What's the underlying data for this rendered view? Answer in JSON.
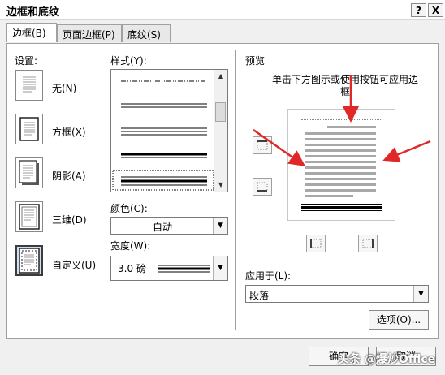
{
  "window": {
    "title": "边框和底纹",
    "help": "?",
    "close": "X"
  },
  "tabs": [
    {
      "label": "边框(B)"
    },
    {
      "label": "页面边框(P)"
    },
    {
      "label": "底纹(S)"
    }
  ],
  "settings": {
    "heading": "设置:",
    "items": [
      {
        "label": "无(N)"
      },
      {
        "label": "方框(X)"
      },
      {
        "label": "阴影(A)"
      },
      {
        "label": "三维(D)"
      },
      {
        "label": "自定义(U)"
      }
    ]
  },
  "style": {
    "heading": "样式(Y):"
  },
  "color": {
    "heading": "颜色(C):",
    "value": "自动"
  },
  "width": {
    "heading": "宽度(W):",
    "value": "3.0 磅"
  },
  "preview": {
    "heading": "预览",
    "hint": "单击下方图示或使用按钮可应用边框"
  },
  "apply_to": {
    "heading": "应用于(L):",
    "value": "段落"
  },
  "buttons": {
    "options": "选项(O)...",
    "ok": "确定",
    "cancel": "取消"
  },
  "watermark": "头条 @爆炒Office",
  "colors": {
    "arrow": "#e02828",
    "panel_bg": "#ffffff",
    "dialog_bg": "#f0f0f0"
  }
}
